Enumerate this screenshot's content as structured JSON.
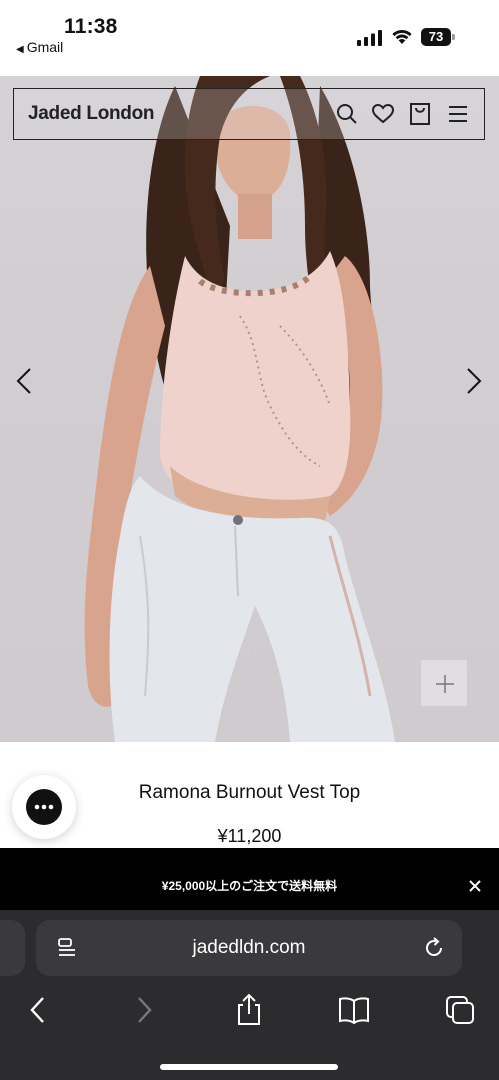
{
  "status_bar": {
    "time": "11:38",
    "back_app": "Gmail",
    "battery": "73"
  },
  "site": {
    "brand": "Jaded London",
    "icons": [
      "search-icon",
      "heart-icon",
      "bag-icon",
      "menu-icon"
    ]
  },
  "product": {
    "title": "Ramona Burnout Vest Top",
    "price": "¥11,200"
  },
  "promo": {
    "text": "¥25,000以上のご注文で送料無料"
  },
  "browser": {
    "url": "jadedldn.com"
  },
  "colors": {
    "promo_bg": "#000000",
    "safari_bg": "#2c2c2e",
    "url_bar_bg": "#3a3a3c"
  }
}
